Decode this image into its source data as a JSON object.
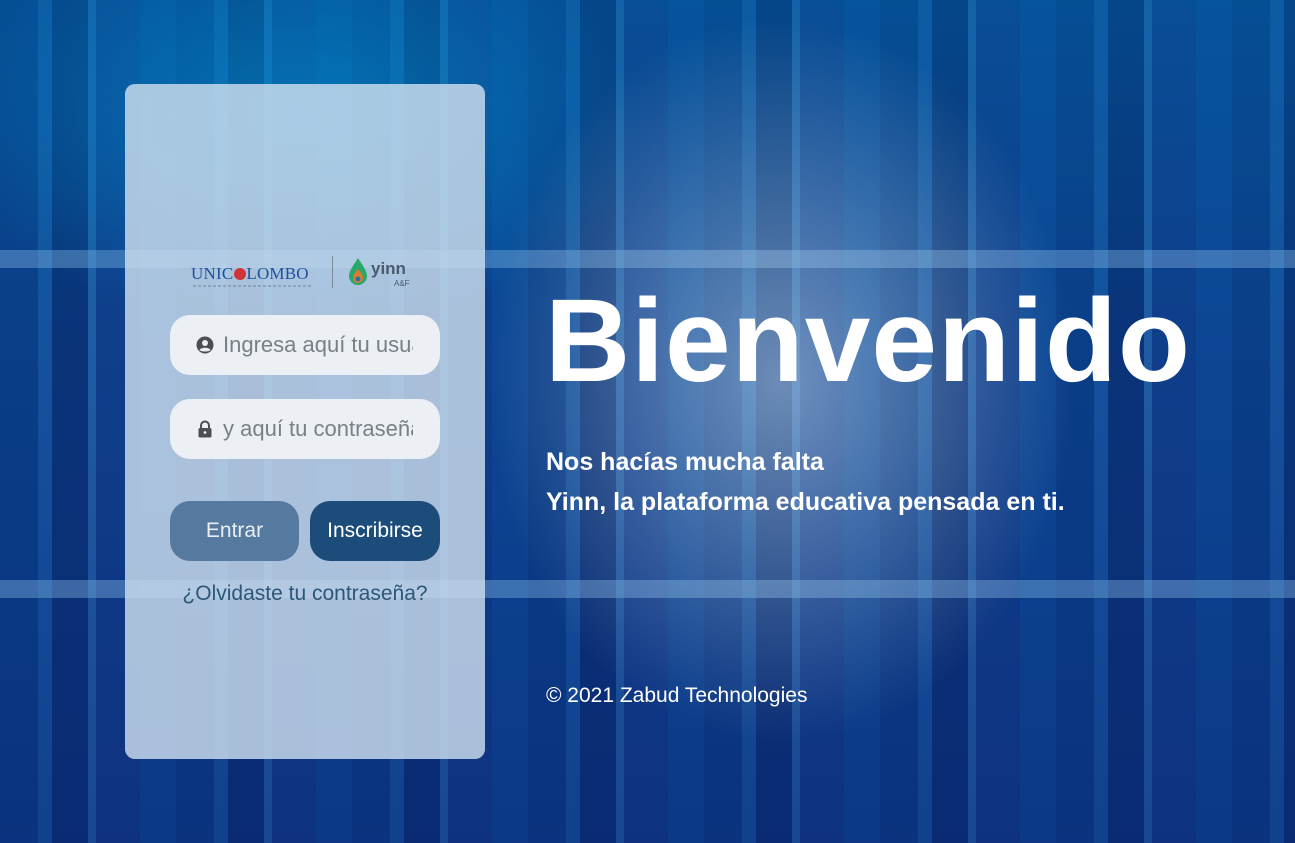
{
  "login_card": {
    "logos": {
      "unicolombo_before": "UNIC",
      "unicolombo_after": "LOMBO",
      "yinn_text": "yinn",
      "yinn_sub": "A&F"
    },
    "username_placeholder": "Ingresa aquí tu usuario",
    "password_placeholder": "y aquí tu contraseña",
    "enter_button": "Entrar",
    "signup_button": "Inscribirse",
    "forgot_link": "¿Olvidaste tu contraseña?"
  },
  "hero": {
    "title": "Bienvenido",
    "line1": "Nos hacías mucha falta",
    "line2": "Yinn, la plataforma educativa pensada en ti."
  },
  "footer": {
    "copyright": "© 2021 Zabud Technologies"
  },
  "icons": {
    "user": "user-circle-icon",
    "password": "lock-icon"
  },
  "colors": {
    "enter_button": "#55799f",
    "signup_button": "#1b4c7a",
    "link": "#2d5678"
  }
}
